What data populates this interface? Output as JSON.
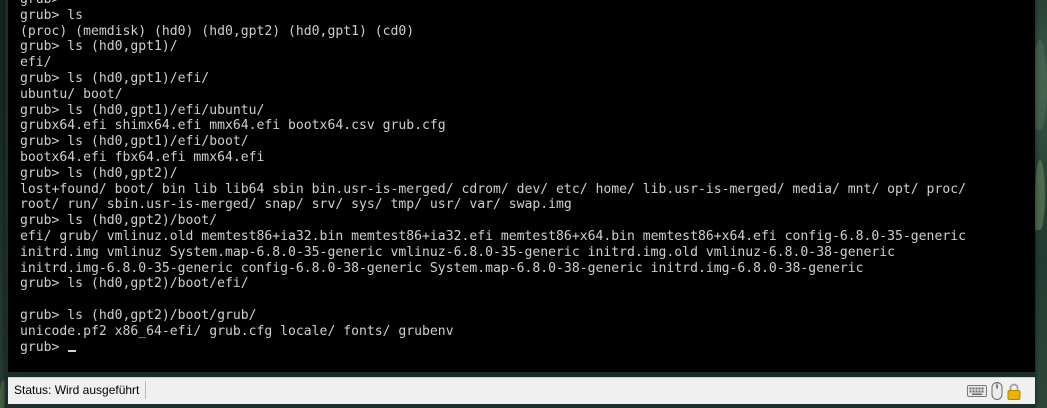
{
  "terminal": {
    "lines": [
      "grub>",
      "grub> ls",
      "(proc) (memdisk) (hd0) (hd0,gpt2) (hd0,gpt1) (cd0)",
      "grub> ls (hd0,gpt1)/",
      "efi/",
      "grub> ls (hd0,gpt1)/efi/",
      "ubuntu/ boot/",
      "grub> ls (hd0,gpt1)/efi/ubuntu/",
      "grubx64.efi shimx64.efi mmx64.efi bootx64.csv grub.cfg",
      "grub> ls (hd0,gpt1)/efi/boot/",
      "bootx64.efi fbx64.efi mmx64.efi",
      "grub> ls (hd0,gpt2)/",
      "lost+found/ boot/ bin lib lib64 sbin bin.usr-is-merged/ cdrom/ dev/ etc/ home/ lib.usr-is-merged/ media/ mnt/ opt/ proc/",
      "root/ run/ sbin.usr-is-merged/ snap/ srv/ sys/ tmp/ usr/ var/ swap.img",
      "grub> ls (hd0,gpt2)/boot/",
      "efi/ grub/ vmlinuz.old memtest86+ia32.bin memtest86+ia32.efi memtest86+x64.bin memtest86+x64.efi config-6.8.0-35-generic",
      "initrd.img vmlinuz System.map-6.8.0-35-generic vmlinuz-6.8.0-35-generic initrd.img.old vmlinuz-6.8.0-38-generic",
      "initrd.img-6.8.0-35-generic config-6.8.0-38-generic System.map-6.8.0-38-generic initrd.img-6.8.0-38-generic",
      "grub> ls (hd0,gpt2)/boot/efi/",
      "",
      "grub> ls (hd0,gpt2)/boot/grub/",
      "unicode.pf2 x86_64-efi/ grub.cfg locale/ fonts/ grubenv"
    ],
    "prompt": "grub> "
  },
  "statusbar": {
    "text": "Status: Wird ausgeführt",
    "icons": [
      "keyboard-icon",
      "mouse-icon",
      "lock-icon"
    ]
  },
  "colors": {
    "terminal_bg": "#000000",
    "terminal_fg": "#cfcfcf",
    "statusbar_bg": "#f0f0f0",
    "lock_icon": "#e8b400"
  }
}
